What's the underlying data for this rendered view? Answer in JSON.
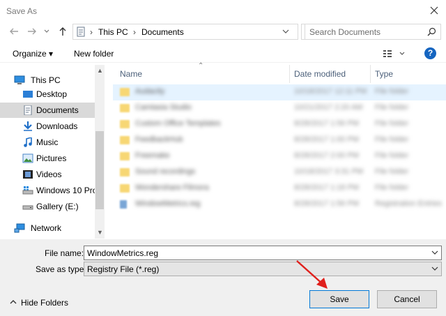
{
  "window": {
    "title": "Save As"
  },
  "address": {
    "crumbs": [
      "This PC",
      "Documents"
    ],
    "search_placeholder": "Search Documents"
  },
  "toolbar": {
    "organize_label": "Organize ▾",
    "new_folder_label": "New folder",
    "help_label": "?"
  },
  "nav": {
    "items": [
      {
        "label": "This PC",
        "icon": "pc-icon"
      },
      {
        "label": "Desktop",
        "icon": "desktop-icon"
      },
      {
        "label": "Documents",
        "icon": "documents-icon",
        "selected": true
      },
      {
        "label": "Downloads",
        "icon": "downloads-icon"
      },
      {
        "label": "Music",
        "icon": "music-icon"
      },
      {
        "label": "Pictures",
        "icon": "pictures-icon"
      },
      {
        "label": "Videos",
        "icon": "videos-icon"
      },
      {
        "label": "Windows 10 Pro",
        "icon": "drive-icon"
      },
      {
        "label": "Gallery (E:)",
        "icon": "drive-icon"
      },
      {
        "label": "Network",
        "icon": "network-icon"
      }
    ]
  },
  "files": {
    "columns": [
      "Name",
      "Date modified",
      "Type"
    ],
    "rows": [
      {
        "name": "Audacity",
        "date": "10/18/2017 12:11 PM",
        "type": "File folder",
        "kind": "folder",
        "selected": true
      },
      {
        "name": "Camtasia Studio",
        "date": "10/21/2017 2:20 AM",
        "type": "File folder",
        "kind": "folder"
      },
      {
        "name": "Custom Office Templates",
        "date": "8/28/2017 1:56 PM",
        "type": "File folder",
        "kind": "folder"
      },
      {
        "name": "FeedbackHub",
        "date": "8/28/2017 1:00 PM",
        "type": "File folder",
        "kind": "folder"
      },
      {
        "name": "Freemake",
        "date": "8/28/2017 2:00 PM",
        "type": "File folder",
        "kind": "folder"
      },
      {
        "name": "Sound recordings",
        "date": "10/18/2017 3:31 PM",
        "type": "File folder",
        "kind": "folder"
      },
      {
        "name": "Wondershare Filmora",
        "date": "8/28/2017 1:18 PM",
        "type": "File folder",
        "kind": "folder"
      },
      {
        "name": "WindowMetrics.reg",
        "date": "8/28/2017 1:56 PM",
        "type": "Registration Entries",
        "kind": "reg"
      }
    ]
  },
  "save": {
    "file_name_label": "File name:",
    "file_name_value": "WindowMetrics.reg",
    "type_label": "Save as type:",
    "type_value": "Registry File (*.reg)",
    "hide_folders_label": "Hide Folders",
    "save_label": "Save",
    "cancel_label": "Cancel"
  },
  "colors": {
    "accent": "#0078d7",
    "selection": "#e5f3ff",
    "annotation": "#e0201c"
  }
}
